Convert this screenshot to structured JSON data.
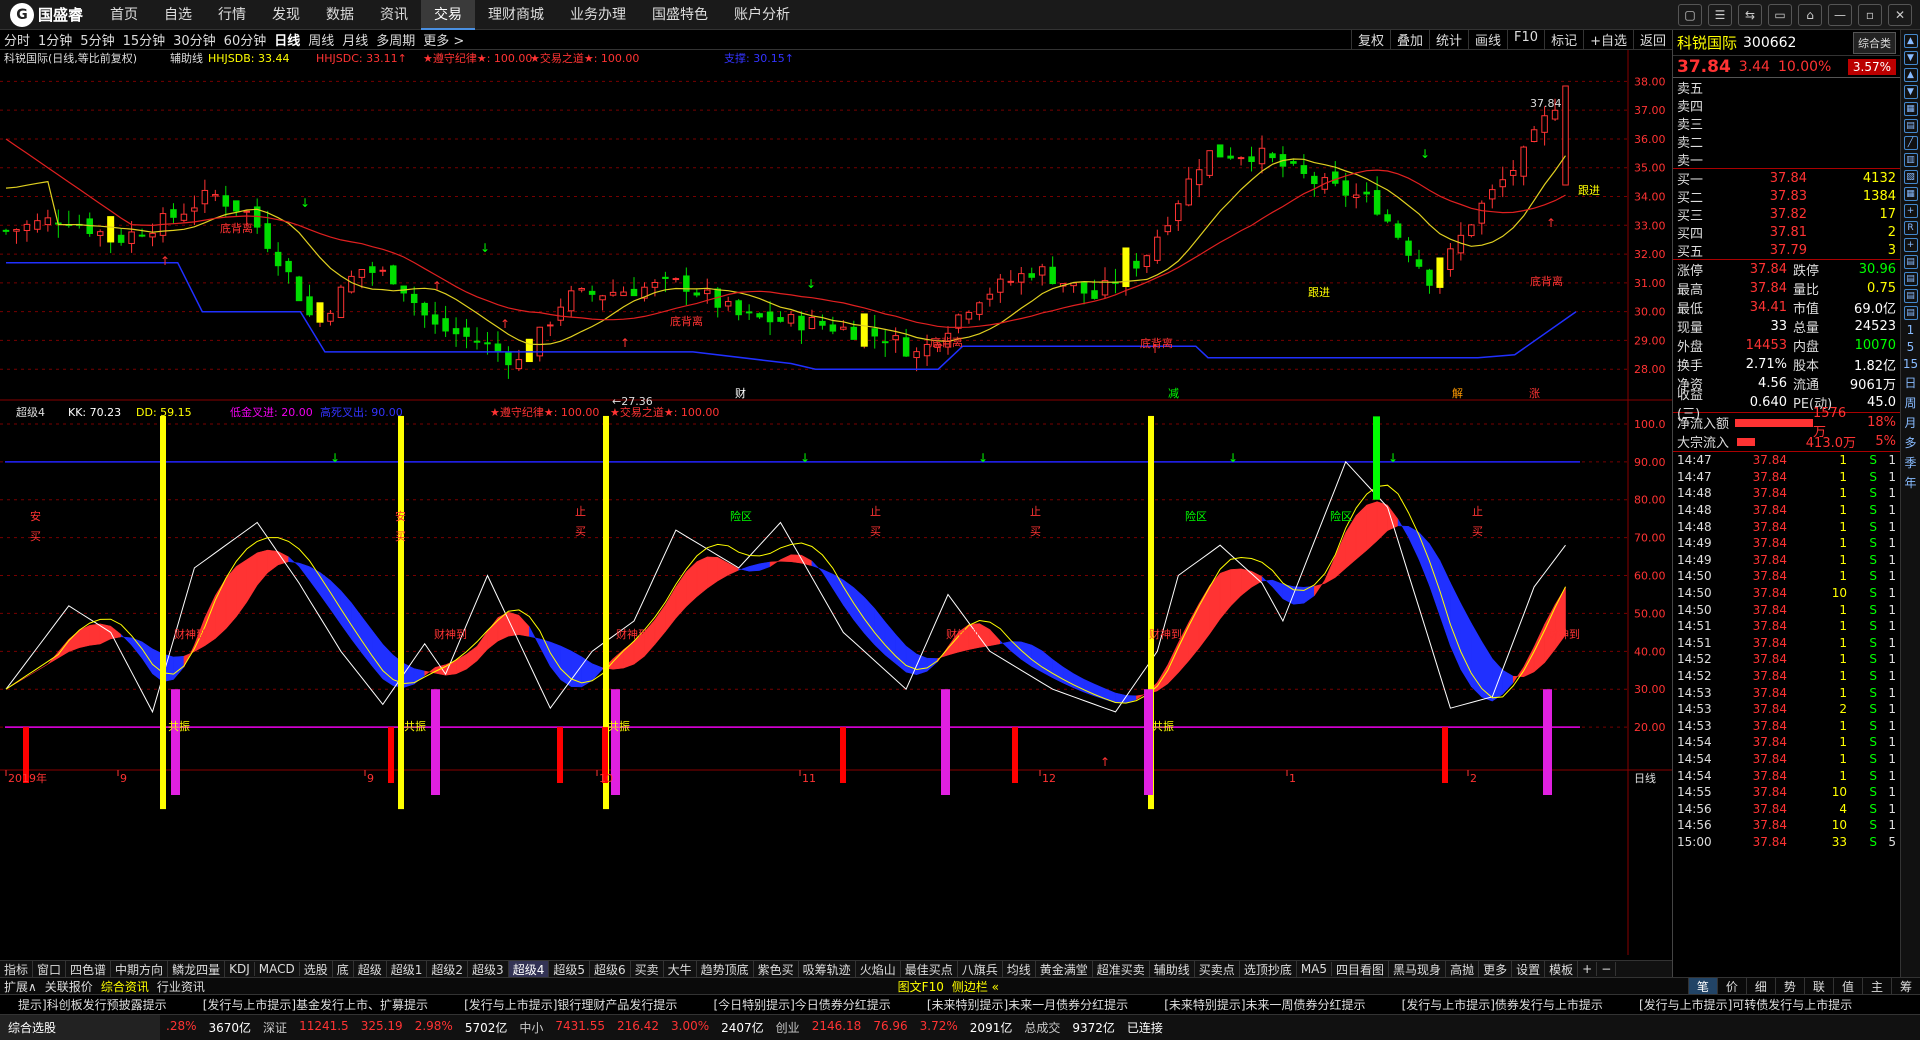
{
  "nav": {
    "logo": "国盛睿",
    "items": [
      "首页",
      "自选",
      "行情",
      "发现",
      "数据",
      "资讯",
      "交易",
      "理财商城",
      "业务办理",
      "国盛特色",
      "账户分析"
    ],
    "active": "交易",
    "win_buttons": [
      "▢",
      "☰",
      "⇆",
      "▭",
      "⌂",
      "—",
      "▫",
      "✕"
    ]
  },
  "periods": {
    "items": [
      "分时",
      "1分钟",
      "5分钟",
      "15分钟",
      "30分钟",
      "60分钟",
      "日线",
      "周线",
      "月线",
      "多周期",
      "更多 >"
    ],
    "active": "日线"
  },
  "chart_tools": [
    "复权",
    "叠加",
    "统计",
    "画线",
    "F10",
    "标记",
    "+自选",
    "返回"
  ],
  "main_header": {
    "title": "科锐国际(日线,等比前复权)",
    "aux": "辅助线",
    "hhjsdb": "HHJSDB: 33.44",
    "hhjsdc": "HHJSDC: 33.11↑",
    "jilv": "★遵守纪律★: 100.00",
    "zhidao": "★交易之道★: 100.00",
    "support": "支撑: 30.15↑"
  },
  "sub_header": {
    "name": "超级4",
    "kk": "KK: 70.23",
    "dd": "DD: 59.15",
    "low_gold": "低金叉进: 20.00",
    "high_dead": "高死叉出: 90.00",
    "jilv": "★遵守纪律★: 100.00",
    "zhidao": "★交易之道★: 100.00"
  },
  "price_axis": [
    "38.00",
    "37.00",
    "36.00",
    "35.00",
    "34.00",
    "33.00",
    "32.00",
    "31.00",
    "30.00",
    "29.00",
    "28.00"
  ],
  "osc_axis": [
    "100.0",
    "90.00",
    "80.00",
    "70.00",
    "60.00",
    "50.00",
    "40.00",
    "30.00",
    "20.00"
  ],
  "time_axis": [
    "2019年",
    "9",
    "9",
    "10",
    "11",
    "12",
    "1",
    "2",
    "日线"
  ],
  "annotations": {
    "high": "37.84",
    "low": "27.36",
    "dibeili": "底背离",
    "genjin": "跟进",
    "cai": "财",
    "xian": "减",
    "jie": "解",
    "zhang": "涨",
    "ansheng": "安",
    "mai": "买",
    "zhi": "止",
    "xianqu": "险区",
    "caishen": "财神到",
    "gongzhen": "共振"
  },
  "quote": {
    "name": "科锐国际",
    "code": "300662",
    "badge": "综合类",
    "price": "37.84",
    "change": "3.44",
    "pct": "10.00%",
    "pct_box": "3.57%"
  },
  "sell": [
    {
      "l": "卖五",
      "p": "",
      "v": ""
    },
    {
      "l": "卖四",
      "p": "",
      "v": ""
    },
    {
      "l": "卖三",
      "p": "",
      "v": ""
    },
    {
      "l": "卖二",
      "p": "",
      "v": ""
    },
    {
      "l": "卖一",
      "p": "",
      "v": ""
    }
  ],
  "buy": [
    {
      "l": "买一",
      "p": "37.84",
      "v": "4132"
    },
    {
      "l": "买二",
      "p": "37.83",
      "v": "1384"
    },
    {
      "l": "买三",
      "p": "37.82",
      "v": "17"
    },
    {
      "l": "买四",
      "p": "37.81",
      "v": "2"
    },
    {
      "l": "买五",
      "p": "37.79",
      "v": "3"
    }
  ],
  "stats": [
    {
      "l": "涨停",
      "v": "37.84",
      "vc": "red",
      "l2": "跌停",
      "v2": "30.96",
      "v2c": "green"
    },
    {
      "l": "最高",
      "v": "37.84",
      "vc": "red",
      "l2": "量比",
      "v2": "0.75",
      "v2c": "yellow"
    },
    {
      "l": "最低",
      "v": "34.41",
      "vc": "red",
      "l2": "市值",
      "v2": "69.0亿",
      "v2c": "white"
    },
    {
      "l": "现量",
      "v": "33",
      "vc": "white",
      "l2": "总量",
      "v2": "24523",
      "v2c": "white"
    },
    {
      "l": "外盘",
      "v": "14453",
      "vc": "red",
      "l2": "内盘",
      "v2": "10070",
      "v2c": "green"
    },
    {
      "l": "换手",
      "v": "2.71%",
      "vc": "white",
      "l2": "股本",
      "v2": "1.82亿",
      "v2c": "white"
    },
    {
      "l": "净资",
      "v": "4.56",
      "vc": "white",
      "l2": "流通",
      "v2": "9061万",
      "v2c": "white"
    },
    {
      "l": "收益(三)",
      "v": "0.640",
      "vc": "white",
      "l2": "PE(动)",
      "v2": "45.0",
      "v2c": "white"
    }
  ],
  "flows": [
    {
      "l": "净流入额",
      "v": "1576万",
      "p": "18%",
      "bar": 90
    },
    {
      "l": "大宗流入",
      "v": "413.0万",
      "p": "5%",
      "bar": 20
    }
  ],
  "ticks": [
    [
      "14:47",
      "37.84",
      "1",
      "S",
      "1"
    ],
    [
      "14:47",
      "37.84",
      "1",
      "S",
      "1"
    ],
    [
      "14:48",
      "37.84",
      "1",
      "S",
      "1"
    ],
    [
      "14:48",
      "37.84",
      "1",
      "S",
      "1"
    ],
    [
      "14:48",
      "37.84",
      "1",
      "S",
      "1"
    ],
    [
      "14:49",
      "37.84",
      "1",
      "S",
      "1"
    ],
    [
      "14:49",
      "37.84",
      "1",
      "S",
      "1"
    ],
    [
      "14:50",
      "37.84",
      "1",
      "S",
      "1"
    ],
    [
      "14:50",
      "37.84",
      "10",
      "S",
      "1"
    ],
    [
      "14:50",
      "37.84",
      "1",
      "S",
      "1"
    ],
    [
      "14:51",
      "37.84",
      "1",
      "S",
      "1"
    ],
    [
      "14:51",
      "37.84",
      "1",
      "S",
      "1"
    ],
    [
      "14:52",
      "37.84",
      "1",
      "S",
      "1"
    ],
    [
      "14:52",
      "37.84",
      "1",
      "S",
      "1"
    ],
    [
      "14:53",
      "37.84",
      "1",
      "S",
      "1"
    ],
    [
      "14:53",
      "37.84",
      "2",
      "S",
      "1"
    ],
    [
      "14:53",
      "37.84",
      "1",
      "S",
      "1"
    ],
    [
      "14:54",
      "37.84",
      "1",
      "S",
      "1"
    ],
    [
      "14:54",
      "37.84",
      "1",
      "S",
      "1"
    ],
    [
      "14:54",
      "37.84",
      "1",
      "S",
      "1"
    ],
    [
      "14:55",
      "37.84",
      "10",
      "S",
      "1"
    ],
    [
      "14:56",
      "37.84",
      "4",
      "S",
      "1"
    ],
    [
      "14:56",
      "37.84",
      "10",
      "S",
      "1"
    ],
    [
      "15:00",
      "37.84",
      "33",
      "S",
      "5"
    ]
  ],
  "ind_tabs": [
    "指标",
    "窗口",
    "四色谱",
    "中期方向",
    "鳞龙四量",
    "KDJ",
    "MACD",
    "选股",
    "底",
    "超级",
    "超级1",
    "超级2",
    "超级3",
    "超级4",
    "超级5",
    "超级6",
    "买卖",
    "大牛",
    "趋势顶底",
    "紫色买",
    "吸筹轨迹",
    "火焰山",
    "最佳买点",
    "八旗兵",
    "均线",
    "黄金满堂",
    "超准买卖",
    "辅助线",
    "买卖点",
    "选顶抄底",
    "MA5",
    "四目看图",
    "黑马现身",
    "高抛",
    "更多",
    "设置",
    "模板",
    "+",
    "−"
  ],
  "ind_active": "超级4",
  "sub_tabs": [
    "扩展∧",
    "关联报价",
    "综合资讯",
    "行业资讯"
  ],
  "sub_active": "综合资讯",
  "rp_left": "图文F10",
  "rp_side": "侧边栏 «",
  "rp_tabs": [
    "笔",
    "价",
    "细",
    "势",
    "联",
    "值",
    "主",
    "筹"
  ],
  "rp_active": "笔",
  "ticker": [
    "提示]科创板发行预披露提示",
    "[发行与上市提示]基金发行上市、扩募提示",
    "[发行与上市提示]银行理财产品发行提示",
    "[今日特别提示]今日债券分红提示",
    "[未来特别提示]未来一月债券分红提示",
    "[未来特别提示]未来一周债券分红提示",
    "[发行与上市提示]债券发行与上市提示",
    "[发行与上市提示]可转债发行与上市提示"
  ],
  "status": {
    "tab": "综合选股",
    "items": [
      ".28%",
      "3670亿",
      "深证",
      "11241.5",
      "325.19",
      "2.98%",
      "5702亿",
      "中小",
      "7431.55",
      "216.42",
      "3.00%",
      "2407亿",
      "创业",
      "2146.18",
      "76.96",
      "3.72%",
      "2091亿",
      "总成交",
      "9372亿",
      "已连接"
    ]
  },
  "colors": {
    "up": "#ff3333",
    "down": "#00dd00",
    "accent": "#ffff00",
    "ma_red": "#e02020",
    "ma_yellow": "#e0d020",
    "support": "#2030ff",
    "magenta": "#e020e0"
  }
}
